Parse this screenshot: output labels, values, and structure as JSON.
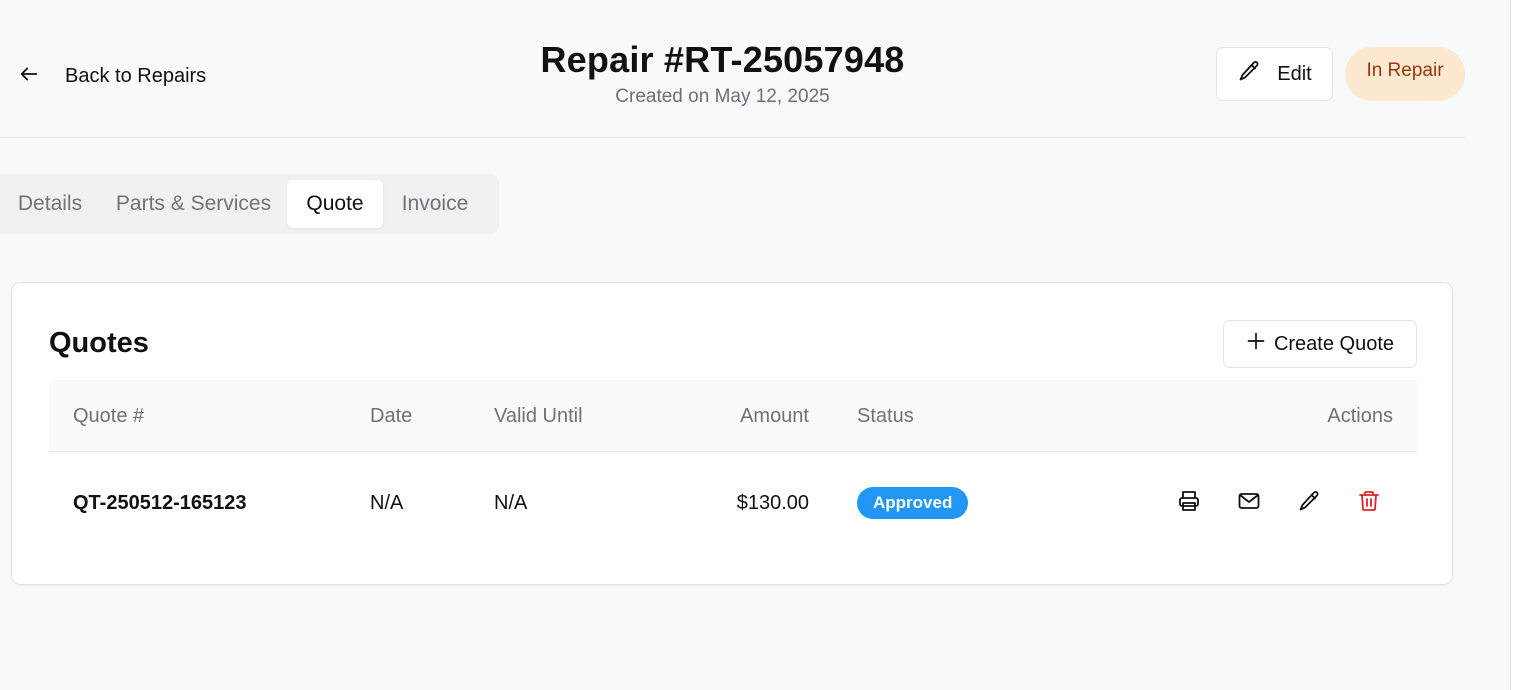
{
  "header": {
    "back_label": "Back to Repairs",
    "title": "Repair #RT-25057948",
    "subtitle": "Created on May 12, 2025",
    "edit_label": "Edit",
    "status_label": "In Repair"
  },
  "tabs": [
    {
      "label": "Details"
    },
    {
      "label": "Parts & Services"
    },
    {
      "label": "Quote",
      "active": true
    },
    {
      "label": "Invoice"
    }
  ],
  "quotes": {
    "title": "Quotes",
    "create_label": "Create Quote",
    "columns": [
      "Quote #",
      "Date",
      "Valid Until",
      "Amount",
      "Status",
      "Actions"
    ],
    "rows": [
      {
        "quote_no": "QT-250512-165123",
        "date": "N/A",
        "valid_until": "N/A",
        "amount": "$130.00",
        "status": "Approved"
      }
    ]
  },
  "icons": {
    "back": "arrow-left-icon",
    "edit": "pencil-icon",
    "create": "plus-icon",
    "print": "printer-icon",
    "email": "mail-icon",
    "edit_row": "pencil-icon",
    "delete": "trash-icon"
  },
  "colors": {
    "status_pill_bg": "#fde8d0",
    "status_pill_text": "#9a3412",
    "approved_badge": "#2196f3",
    "delete_icon": "#dc2626"
  }
}
